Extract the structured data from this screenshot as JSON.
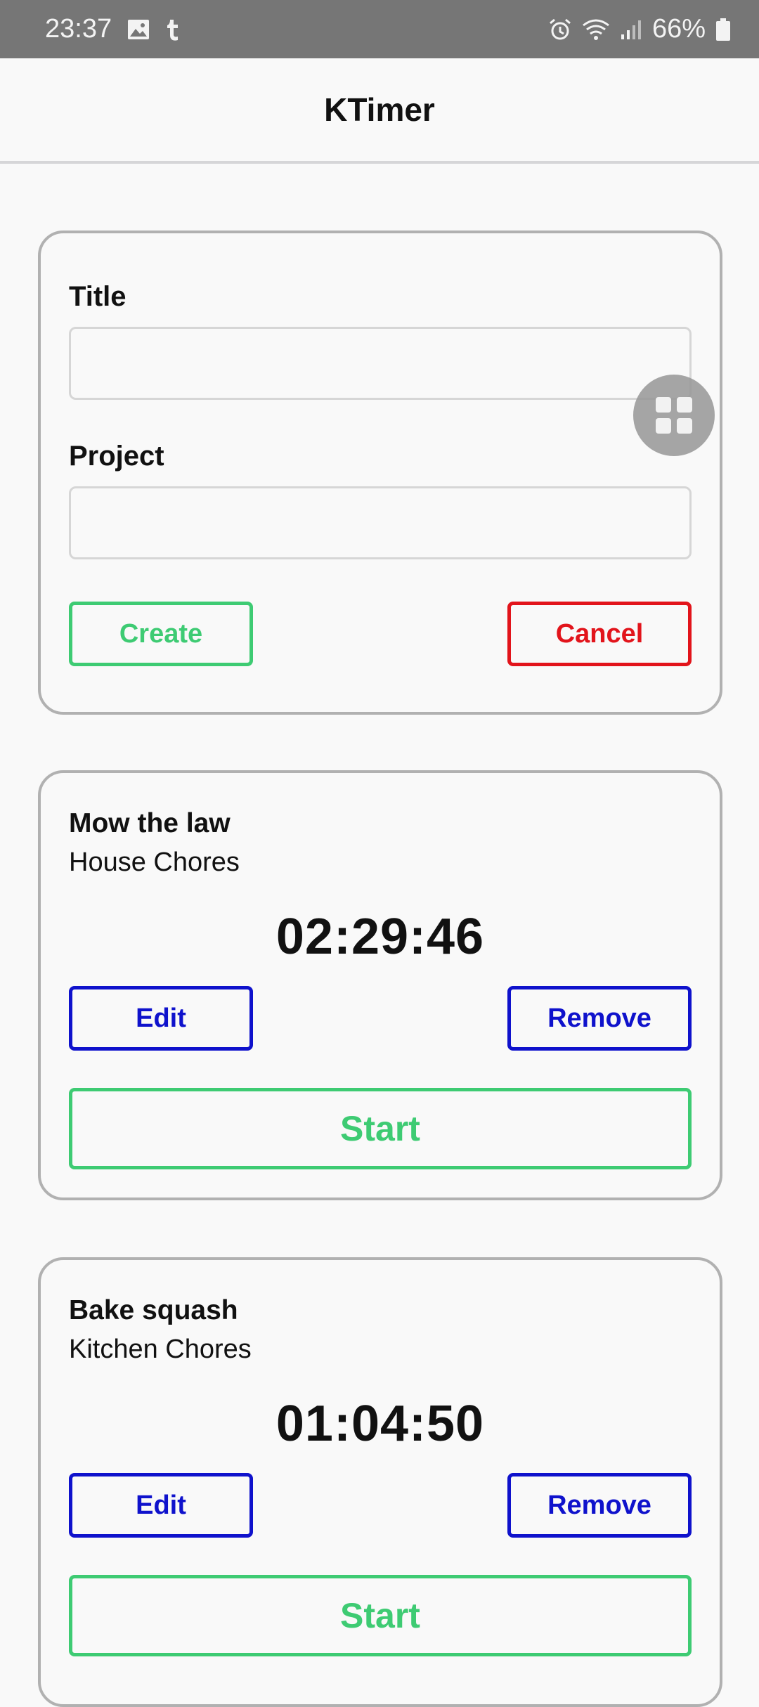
{
  "status_bar": {
    "time": "23:37",
    "battery": "66%",
    "left_icons": [
      "image-icon",
      "tumblr-icon"
    ],
    "right_icons": [
      "alarm-icon",
      "wifi-icon",
      "signal-icon",
      "battery-icon"
    ]
  },
  "app_bar": {
    "title": "KTimer"
  },
  "form": {
    "title_label": "Title",
    "title_value": "",
    "project_label": "Project",
    "project_value": "",
    "create_label": "Create",
    "cancel_label": "Cancel"
  },
  "timers": [
    {
      "title": "Mow the law",
      "project": "House Chores",
      "elapsed": "02:29:46",
      "edit_label": "Edit",
      "remove_label": "Remove",
      "start_label": "Start"
    },
    {
      "title": "Bake squash",
      "project": "Kitchen Chores",
      "elapsed": "01:04:50",
      "edit_label": "Edit",
      "remove_label": "Remove",
      "start_label": "Start"
    }
  ],
  "floating_button": {
    "icon": "grid-icon"
  },
  "colors": {
    "green": "#3ecb73",
    "red": "#e2141b",
    "blue": "#0f12cc",
    "card_border": "#b1b1b1",
    "status_bar": "#767676",
    "background": "#f9f9f9"
  }
}
